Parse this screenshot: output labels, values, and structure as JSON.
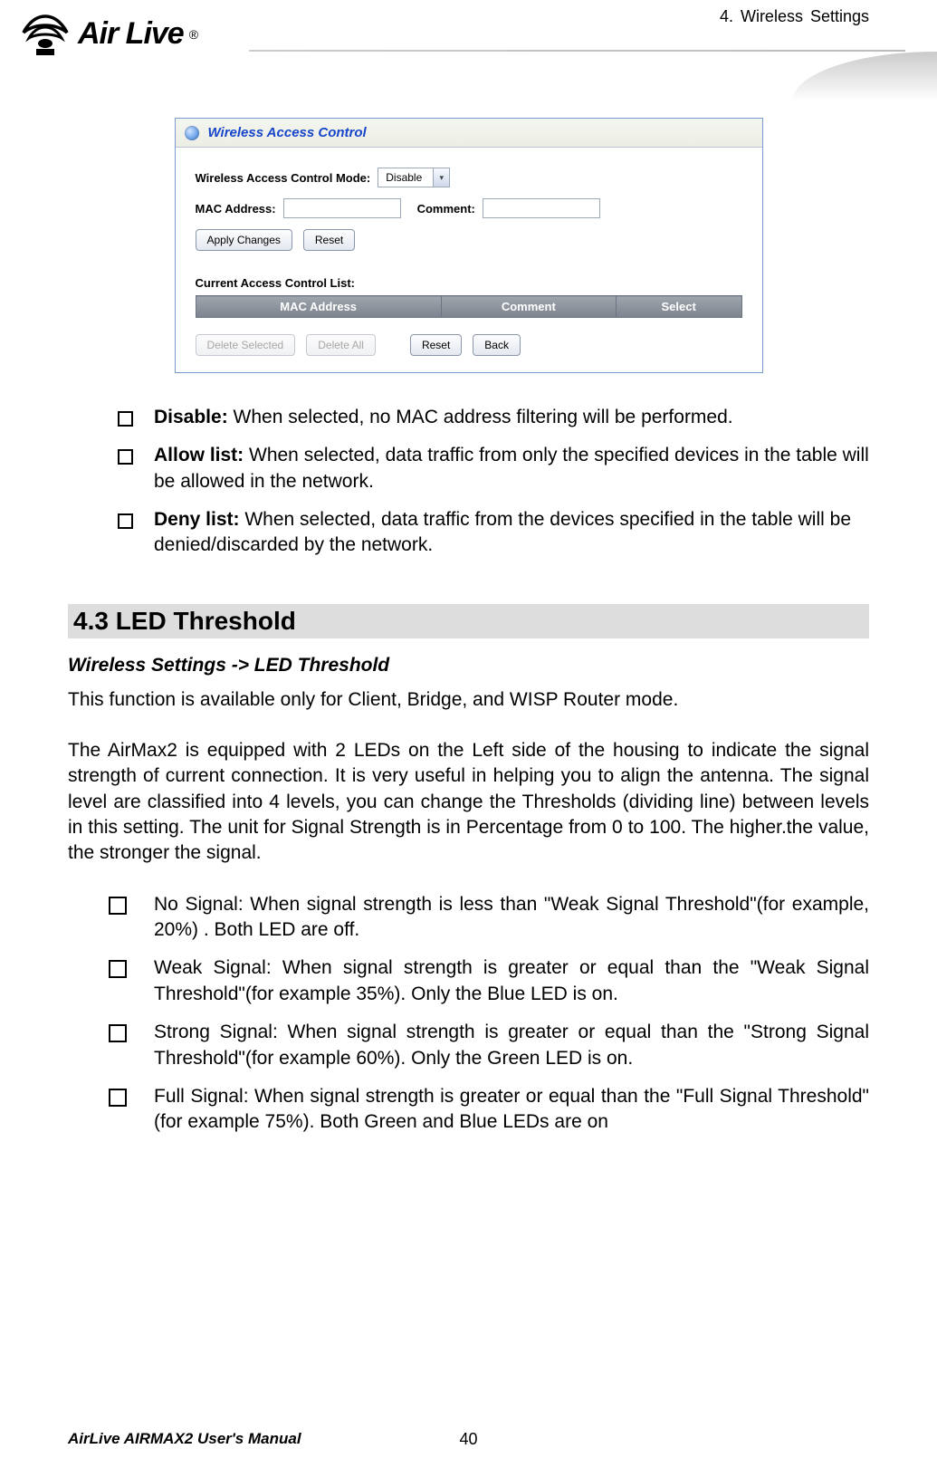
{
  "header": {
    "logo_text": "Air Live",
    "breadcrumb": "4. Wireless Settings"
  },
  "screenshot": {
    "panel_title": "Wireless Access Control",
    "mode_label": "Wireless Access Control Mode:",
    "mode_value": "Disable",
    "mac_label": "MAC Address:",
    "comment_label": "Comment:",
    "btn_apply": "Apply Changes",
    "btn_reset": "Reset",
    "list_heading": "Current Access Control List:",
    "th_mac": "MAC Address",
    "th_comment": "Comment",
    "th_select": "Select",
    "btn_delete_selected": "Delete Selected",
    "btn_delete_all": "Delete All",
    "btn_reset2": "Reset",
    "btn_back": "Back"
  },
  "options": {
    "disable_label": "Disable:",
    "disable_text": " When selected, no MAC address filtering will be performed.",
    "allow_label": "Allow list:",
    "allow_text": " When selected, data traffic from only the specified devices in the table will be allowed in the network.",
    "deny_label": "Deny list:",
    "deny_text": " When selected, data traffic from the devices specified in the table will be denied/discarded by the network."
  },
  "section": {
    "title": "4.3 LED  Threshold",
    "breadcrumb": "Wireless Settings -> LED Threshold",
    "note": "This function is available only for Client, Bridge, and WISP Router mode.",
    "description": "The AirMax2 is equipped with 2 LEDs on the Left side of the housing to indicate the signal strength of current connection.   It is very useful in helping you to align the antenna.   The signal level are classified into 4 levels, you can change the Thresholds (dividing line) between levels in this setting.   The unit for Signal Strength is in Percentage from 0 to 100.   The higher.the value, the stronger the signal."
  },
  "signals": {
    "no_label": "No Signal",
    "no_text": ": When signal strength is less than \"Weak Signal Threshold\"(for example, 20%) . Both LED are off.",
    "weak_label": "Weak Signal",
    "weak_text": ": When signal strength is greater or equal than the \"Weak Signal Threshold\"(for example 35%).   Only the Blue LED is on.",
    "strong_label": "Strong Signal",
    "strong_text": ": When signal strength is greater or equal than the \"Strong Signal Threshold\"(for example 60%).   Only the Green LED is on.",
    "full_label": "Full Signal",
    "full_text": ": When signal strength is greater or equal than the \"Full Signal Threshold\"(for example 75%).   Both Green and Blue LEDs are on"
  },
  "footer": {
    "manual": "AirLive AIRMAX2 User's Manual",
    "page": "40"
  }
}
